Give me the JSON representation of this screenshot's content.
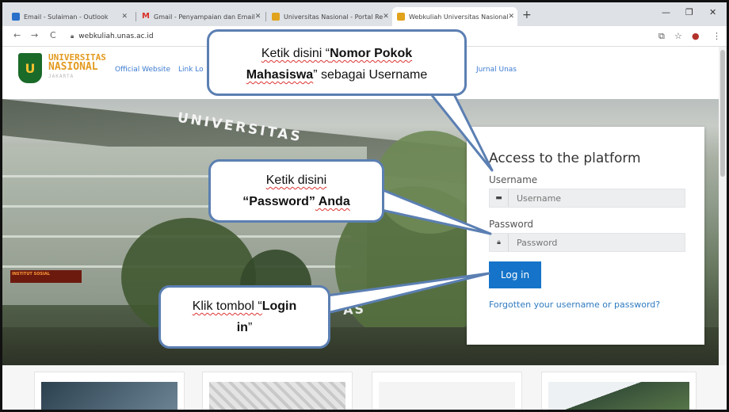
{
  "browser": {
    "tabs": [
      {
        "label": "Email - Sulaiman - Outlook",
        "favicon_color": "#2a6fc9"
      },
      {
        "label": "Gmail - Penyampaian dan Email",
        "favicon_color": "#d93025"
      },
      {
        "label": "Universitas Nasional - Portal Re",
        "favicon_color": "#e1a21c"
      },
      {
        "label": "Webkuliah Universitas Nasional",
        "favicon_color": "#e1a21c"
      }
    ],
    "new_tab": "+",
    "url": "webkuliah.unas.ac.id"
  },
  "site": {
    "logo_mark": "U",
    "logo_line1": "UNIVERSITAS",
    "logo_line2": "NASIONAL",
    "logo_line3": "JAKARTA",
    "nav_links": [
      "Official Website",
      "Link Lo"
    ],
    "nav_right": "Jurnal Unas"
  },
  "hero": {
    "building_sign": "UNIVERSITAS",
    "red_sign": "INSTITUT SOSIAL",
    "lower_sign": "AS"
  },
  "login": {
    "title": "Access to the platform",
    "username_label": "Username",
    "username_placeholder": "Username",
    "password_label": "Password",
    "password_placeholder": "Password",
    "button": "Log in",
    "forgot": "Forgotten your username or password?"
  },
  "callouts": {
    "username": {
      "pre": "Ketik disini “",
      "bold1": "Nomor Pokok",
      "bold2": "Mahasiswa",
      "post": "” sebagai Username"
    },
    "password": {
      "line1": "Ketik disini",
      "bold": "“Password”",
      "post": " Anda"
    },
    "login": {
      "pre": "Klik tombol “",
      "bold1": "Login",
      "bold2": "in",
      "post": "”"
    }
  },
  "colors": {
    "callout_border": "#5b7fb2",
    "login_button": "#1574c9",
    "link": "#2f7bc1",
    "logo_orange": "#e39a1f",
    "logo_green": "#1a6a2a"
  }
}
